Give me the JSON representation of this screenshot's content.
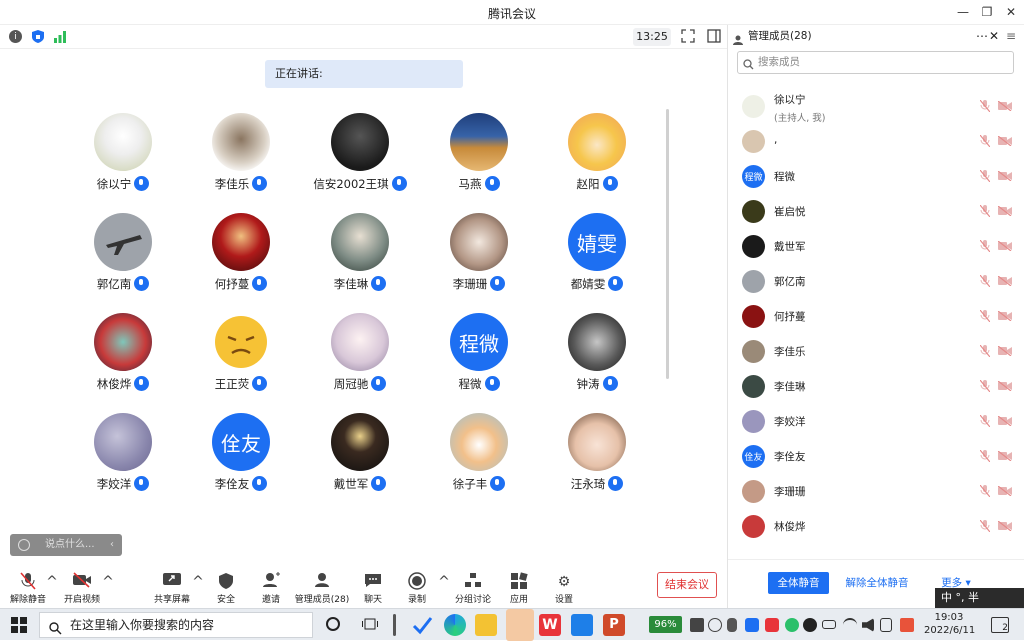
{
  "window": {
    "title": "腾讯会议"
  },
  "meeting_bar": {
    "time": "13:25"
  },
  "speaking_label": "正在讲话:",
  "participants": [
    {
      "name": "徐以宁",
      "avatar": "sketch",
      "mic_color": "#1d6ff2"
    },
    {
      "name": "李佳乐",
      "avatar": "figure",
      "mic_color": "#1d6ff2"
    },
    {
      "name": "信安2002王琪",
      "avatar": "dark",
      "mic_color": "#1d6ff2"
    },
    {
      "name": "马燕",
      "avatar": "dog",
      "mic_color": "#1d6ff2"
    },
    {
      "name": "赵阳",
      "avatar": "cartoon",
      "mic_color": "#1d6ff2"
    },
    {
      "name": "郭亿南",
      "avatar": "plane",
      "mic_color": "#1d6ff2"
    },
    {
      "name": "何抒蔓",
      "avatar": "red",
      "mic_color": "#1d6ff2"
    },
    {
      "name": "李佳琳",
      "avatar": "boy",
      "mic_color": "#1d6ff2"
    },
    {
      "name": "李珊珊",
      "avatar": "girl",
      "mic_color": "#1d6ff2"
    },
    {
      "name": "都婧雯",
      "avatar_text": "婧雯",
      "mic_color": "#1d6ff2"
    },
    {
      "name": "林俊烨",
      "avatar": "anime",
      "mic_color": "#1d6ff2"
    },
    {
      "name": "王正荧",
      "avatar": "emoji",
      "mic_color": "#1d6ff2"
    },
    {
      "name": "周冠驰",
      "avatar": "anime2",
      "mic_color": "#1d6ff2"
    },
    {
      "name": "程微",
      "avatar_text": "程微",
      "mic_color": "#1d6ff2"
    },
    {
      "name": "钟涛",
      "avatar": "ninja",
      "mic_color": "#1d6ff2"
    },
    {
      "name": "李姣洋",
      "avatar": "sky",
      "mic_color": "#1d6ff2"
    },
    {
      "name": "李佺友",
      "avatar_text": "佺友",
      "mic_color": "#1d6ff2"
    },
    {
      "name": "戴世军",
      "avatar": "night",
      "mic_color": "#1d6ff2"
    },
    {
      "name": "徐子丰",
      "avatar": "cat",
      "mic_color": "#1d6ff2"
    },
    {
      "name": "汪永琦",
      "avatar": "baby",
      "mic_color": "#1d6ff2"
    }
  ],
  "chat_input_placeholder": "说点什么...",
  "toolbar": {
    "unmute": "解除静音",
    "video": "开启视频",
    "share": "共享屏幕",
    "security": "安全",
    "invite": "邀请",
    "members": "管理成员(28)",
    "chat": "聊天",
    "record": "录制",
    "breakout": "分组讨论",
    "apps": "应用",
    "settings": "设置",
    "end": "结束会议"
  },
  "panel": {
    "title": "管理成员(28)",
    "search_placeholder": "搜索成员",
    "members": [
      {
        "name": "徐以宁",
        "sub": "(主持人, 我)"
      },
      {
        "name": ","
      },
      {
        "name": "程微",
        "avatar_text": "程微"
      },
      {
        "name": "崔启悦"
      },
      {
        "name": "戴世军"
      },
      {
        "name": "郭亿南"
      },
      {
        "name": "何抒蔓"
      },
      {
        "name": "李佳乐"
      },
      {
        "name": "李佳琳"
      },
      {
        "name": "李姣洋"
      },
      {
        "name": "李佺友",
        "avatar_text": "佺友"
      },
      {
        "name": "李珊珊"
      },
      {
        "name": "林俊烨"
      }
    ],
    "mute_all": "全体静音",
    "unmute_all": "解除全体静音",
    "more": "更多 ▾"
  },
  "taskbar": {
    "search_placeholder": "在这里输入你要搜索的内容",
    "battery": "96%",
    "ime": "中 °, 半",
    "clock_time": "19:03",
    "clock_date": "2022/6/11",
    "notifications": "2"
  },
  "colors": {
    "accent": "#1d6ff2",
    "end": "#e03030"
  }
}
